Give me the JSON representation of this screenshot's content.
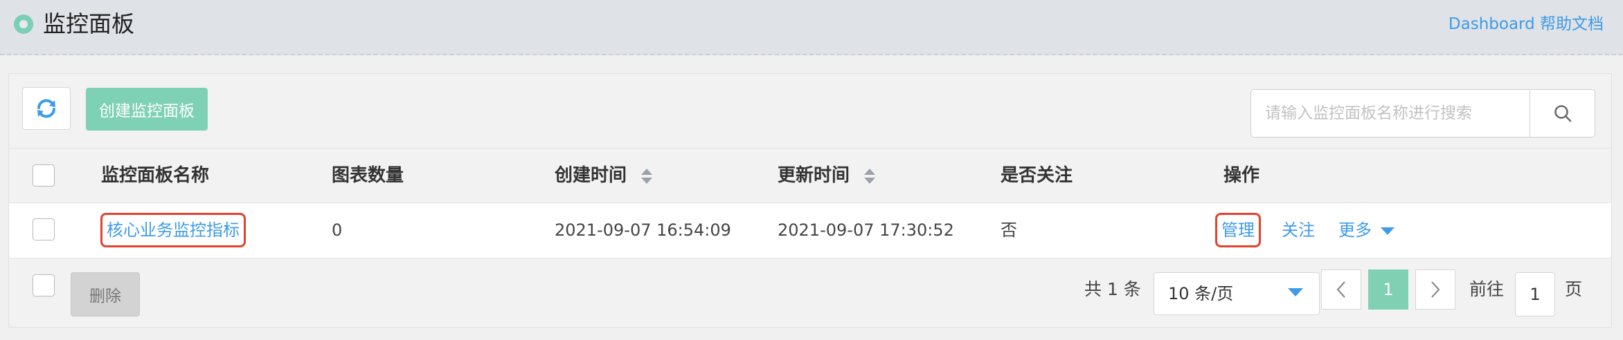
{
  "header": {
    "title": "监控面板",
    "help_link": "Dashboard 帮助文档",
    "status_color": "#7ccfb4"
  },
  "toolbar": {
    "refresh_icon": "refresh-icon",
    "create_label": "创建监控面板",
    "search_placeholder": "请输入监控面板名称进行搜索",
    "search_icon": "search-icon"
  },
  "table": {
    "columns": [
      {
        "label": "监控面板名称",
        "sortable": false
      },
      {
        "label": "图表数量",
        "sortable": false
      },
      {
        "label": "创建时间",
        "sortable": true
      },
      {
        "label": "更新时间",
        "sortable": true
      },
      {
        "label": "是否关注",
        "sortable": false
      },
      {
        "label": "操作",
        "sortable": false
      }
    ],
    "rows": [
      {
        "name": "核心业务监控指标",
        "chart_count": "0",
        "created_at": "2021-09-07 16:54:09",
        "updated_at": "2021-09-07 17:30:52",
        "followed": "否",
        "actions": {
          "manage": "管理",
          "follow": "关注",
          "more": "更多"
        }
      }
    ]
  },
  "footer": {
    "delete_label": "删除",
    "total_text": "共 1 条",
    "page_size": "10 条/页",
    "current_page": "1",
    "goto_label": "前往",
    "goto_value": "1",
    "page_unit": "页"
  },
  "colors": {
    "accent": "#3d9be9",
    "primary_button": "#7fd1b6",
    "highlight_border": "#e3422e"
  }
}
